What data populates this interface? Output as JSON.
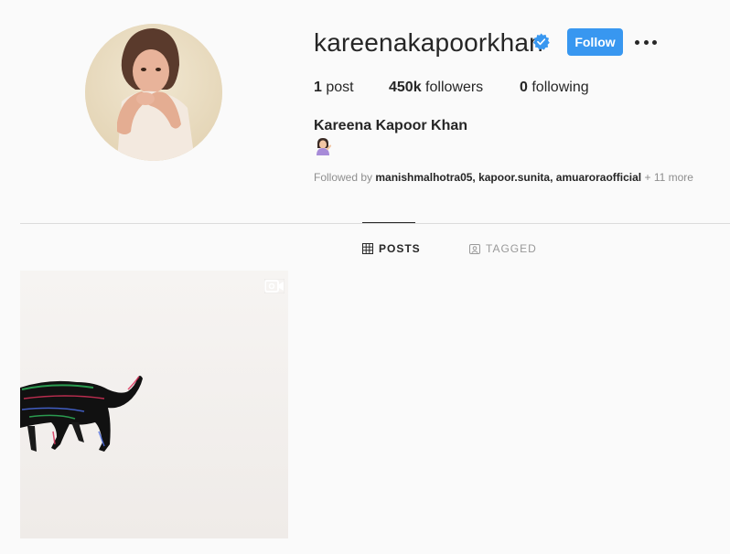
{
  "profile": {
    "username": "kareenakapoorkhan",
    "verified": true,
    "follow_label": "Follow",
    "full_name": "Kareena Kapoor Khan",
    "bio_emoji": "woman-tipping-hand-emoji"
  },
  "stats": {
    "posts_count": "1",
    "posts_label": " post",
    "followers_count": "450k",
    "followers_label": " followers",
    "following_count": "0",
    "following_label": " following"
  },
  "followed_by": {
    "prefix": "Followed by ",
    "names": "manishmalhotra05, kapoor.sunita, amuaroraofficial",
    "more": " + 11 more"
  },
  "tabs": [
    {
      "label": "POSTS",
      "icon": "grid-icon",
      "active": true
    },
    {
      "label": "TAGGED",
      "icon": "tagged-icon",
      "active": false
    }
  ],
  "posts": [
    {
      "type": "video",
      "icon": "video-icon",
      "subject": "cat-image"
    }
  ],
  "colors": {
    "accent": "#3897f0",
    "background": "#fafafa",
    "text": "#262626",
    "muted": "#8e8e8e",
    "divider": "#dbdbdb"
  }
}
